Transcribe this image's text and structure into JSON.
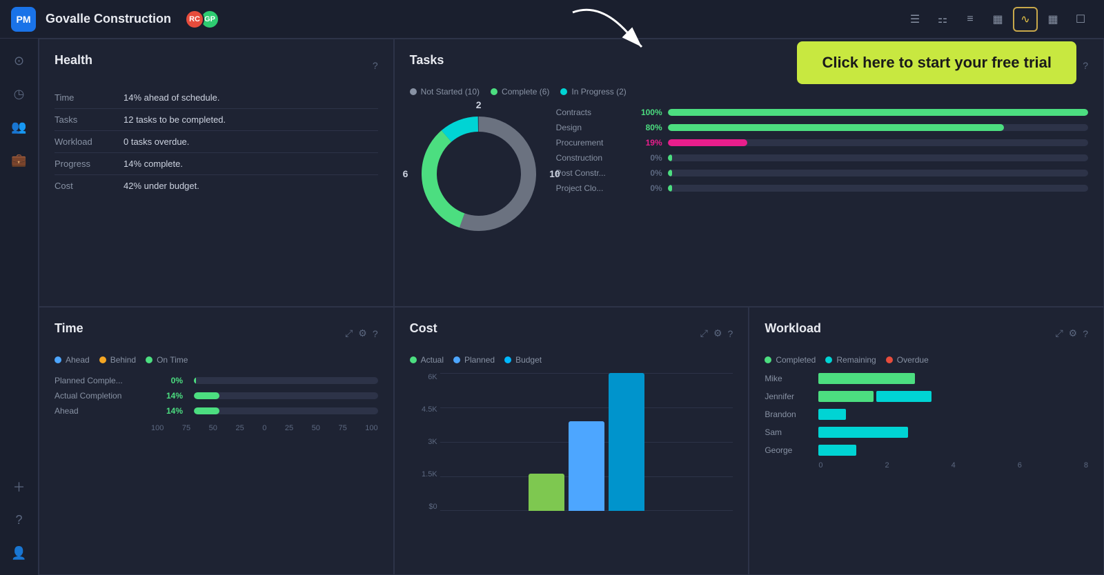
{
  "topbar": {
    "logo_text": "PM",
    "title": "Govalle Construction",
    "avatars": [
      {
        "initials": "RC",
        "color": "#e74c3c"
      },
      {
        "initials": "GP",
        "color": "#2ecc71"
      }
    ],
    "toolbar_icons": [
      "☰",
      "⚏",
      "≡",
      "▦",
      "∿",
      "▦",
      "☐"
    ],
    "active_index": 4
  },
  "trial_banner": {
    "text": "Click here to start your free trial"
  },
  "sidebar": {
    "icons": [
      "⊙",
      "◷",
      "👤",
      "💼"
    ],
    "bottom_icons": [
      "+",
      "?",
      "👤"
    ]
  },
  "health": {
    "title": "Health",
    "rows": [
      {
        "label": "Time",
        "value": "14% ahead of schedule."
      },
      {
        "label": "Tasks",
        "value": "12 tasks to be completed."
      },
      {
        "label": "Workload",
        "value": "0 tasks overdue."
      },
      {
        "label": "Progress",
        "value": "14% complete."
      },
      {
        "label": "Cost",
        "value": "42% under budget."
      }
    ]
  },
  "tasks": {
    "title": "Tasks",
    "legend": [
      {
        "label": "Not Started (10)",
        "color": "#8892a4"
      },
      {
        "label": "Complete (6)",
        "color": "#4cde80"
      },
      {
        "label": "In Progress (2)",
        "color": "#00d4d4"
      }
    ],
    "donut": {
      "not_started": 10,
      "complete": 6,
      "in_progress": 2,
      "total": 18,
      "label_top": "2",
      "label_left": "6",
      "label_right": "10"
    },
    "bars": [
      {
        "label": "Contracts",
        "pct": 100,
        "color": "#4cde80",
        "pct_text": "100%"
      },
      {
        "label": "Design",
        "pct": 80,
        "color": "#4cde80",
        "pct_text": "80%"
      },
      {
        "label": "Procurement",
        "pct": 19,
        "color": "#e91e8c",
        "pct_text": "19%"
      },
      {
        "label": "Construction",
        "pct": 0,
        "color": "#4cde80",
        "pct_text": "0%"
      },
      {
        "label": "Post Constr...",
        "pct": 0,
        "color": "#4cde80",
        "pct_text": "0%"
      },
      {
        "label": "Project Clo...",
        "pct": 0,
        "color": "#4cde80",
        "pct_text": "0%"
      }
    ]
  },
  "time": {
    "title": "Time",
    "legend": [
      {
        "label": "Ahead",
        "color": "#4da6ff"
      },
      {
        "label": "Behind",
        "color": "#f5a623"
      },
      {
        "label": "On Time",
        "color": "#4cde80"
      }
    ],
    "rows": [
      {
        "label": "Planned Comple...",
        "pct": 0,
        "color": "#4cde80",
        "pct_text": "0%"
      },
      {
        "label": "Actual Completion",
        "pct": 14,
        "color": "#4cde80",
        "pct_text": "14%"
      },
      {
        "label": "Ahead",
        "pct": 14,
        "color": "#4cde80",
        "pct_text": "14%"
      }
    ],
    "x_labels": [
      "100",
      "75",
      "50",
      "25",
      "0",
      "25",
      "50",
      "75",
      "100"
    ]
  },
  "cost": {
    "title": "Cost",
    "legend": [
      {
        "label": "Actual",
        "color": "#4cde80"
      },
      {
        "label": "Planned",
        "color": "#4da6ff"
      },
      {
        "label": "Budget",
        "color": "#00b8ff"
      }
    ],
    "y_labels": [
      "6K",
      "4.5K",
      "3K",
      "1.5K",
      "$0"
    ],
    "bars": [
      {
        "actual_h": 40,
        "planned_h": 100,
        "budget_h": 155
      }
    ]
  },
  "workload": {
    "title": "Workload",
    "legend": [
      {
        "label": "Completed",
        "color": "#4cde80"
      },
      {
        "label": "Remaining",
        "color": "#00d4d4"
      },
      {
        "label": "Overdue",
        "color": "#e74c3c"
      }
    ],
    "rows": [
      {
        "name": "Mike",
        "completed": 120,
        "remaining": 0,
        "overdue": 0
      },
      {
        "name": "Jennifer",
        "completed": 80,
        "remaining": 80,
        "overdue": 0
      },
      {
        "name": "Brandon",
        "completed": 0,
        "remaining": 40,
        "overdue": 0
      },
      {
        "name": "Sam",
        "completed": 0,
        "remaining": 120,
        "overdue": 0
      },
      {
        "name": "George",
        "completed": 0,
        "remaining": 50,
        "overdue": 0
      }
    ],
    "x_labels": [
      "0",
      "2",
      "4",
      "6",
      "8"
    ]
  }
}
